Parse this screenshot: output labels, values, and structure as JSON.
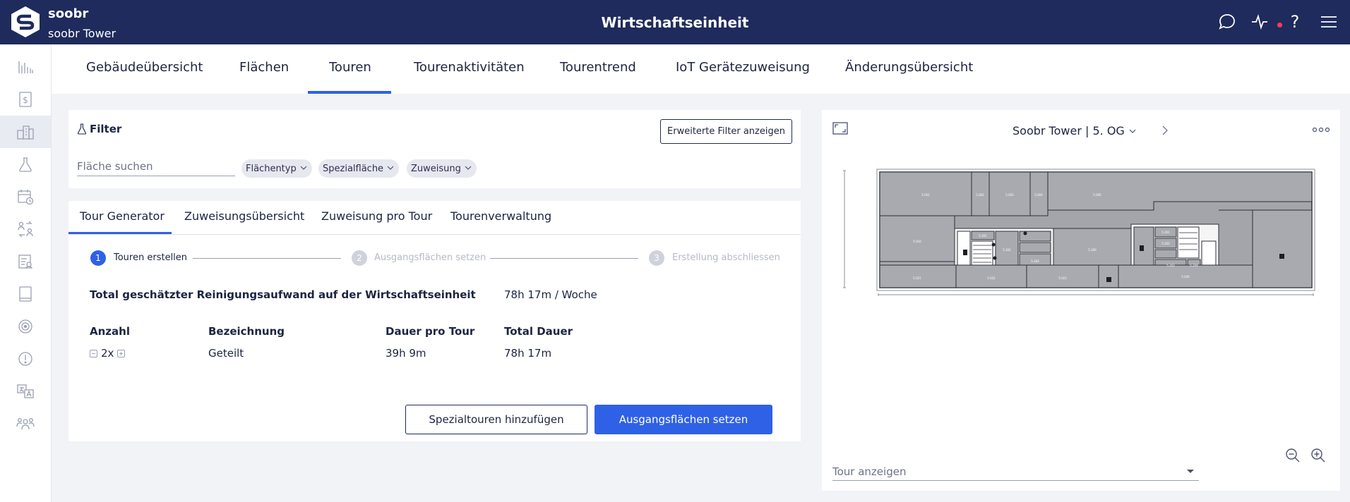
{
  "header": {
    "brand_name": "soobr",
    "brand_subtitle": "soobr Tower",
    "title": "Wirtschaftseinheit",
    "icons": [
      "chat-icon",
      "activity-icon",
      "help-icon",
      "menu-icon"
    ],
    "notification_color": "#ff3b56"
  },
  "sidebar": {
    "items": [
      {
        "icon": "bar-chart-icon"
      },
      {
        "icon": "dollar-document-icon"
      },
      {
        "icon": "buildings-icon",
        "active": true
      },
      {
        "icon": "flask-icon"
      },
      {
        "icon": "calendar-clock-icon"
      },
      {
        "icon": "swap-icon"
      },
      {
        "icon": "report-icon"
      },
      {
        "icon": "tablet-icon"
      },
      {
        "icon": "target-icon"
      },
      {
        "icon": "alert-icon"
      },
      {
        "icon": "translate-icon"
      },
      {
        "icon": "team-icon"
      }
    ]
  },
  "main_tabs": [
    {
      "label": "Gebäudeübersicht"
    },
    {
      "label": "Flächen"
    },
    {
      "label": "Touren",
      "active": true
    },
    {
      "label": "Tourenaktivitäten"
    },
    {
      "label": "Tourentrend"
    },
    {
      "label": "IoT Gerätezuweisung"
    },
    {
      "label": "Änderungsübersicht"
    }
  ],
  "filter": {
    "title": "Filter",
    "advanced_button": "Erweiterte Filter anzeigen",
    "search_placeholder": "Fläche suchen",
    "chips": [
      "Flächentyp",
      "Spezialfläche",
      "Zuweisung"
    ]
  },
  "sub_tabs": [
    {
      "label": "Tour Generator",
      "active": true
    },
    {
      "label": "Zuweisungsübersicht"
    },
    {
      "label": "Zuweisung pro Tour"
    },
    {
      "label": "Tourenverwaltung"
    }
  ],
  "stepper": [
    {
      "number": "1",
      "label": "Touren erstellen",
      "active": true
    },
    {
      "number": "2",
      "label": "Ausgangsflächen setzen"
    },
    {
      "number": "3",
      "label": "Erstellung abschliessen"
    }
  ],
  "summary": {
    "label": "Total geschätzter Reinigungsaufwand auf der Wirtschaftseinheit",
    "value": "78h 17m / Woche"
  },
  "tour_table": {
    "headers": [
      "Anzahl",
      "Bezeichnung",
      "Dauer pro Tour",
      "Total Dauer"
    ],
    "rows": [
      {
        "count": "2x",
        "name": "Geteilt",
        "duration": "39h 9m",
        "total": "78h 17m"
      }
    ]
  },
  "actions": {
    "secondary": "Spezialtouren hinzufügen",
    "primary": "Ausgangsflächen setzen"
  },
  "map": {
    "location": "Soobr Tower | 5. OG",
    "tour_select_placeholder": "Tour anzeigen"
  },
  "colors": {
    "header_bg": "#1e2b5c",
    "accent": "#2f61e6",
    "page_bg": "#f2f3f7"
  }
}
